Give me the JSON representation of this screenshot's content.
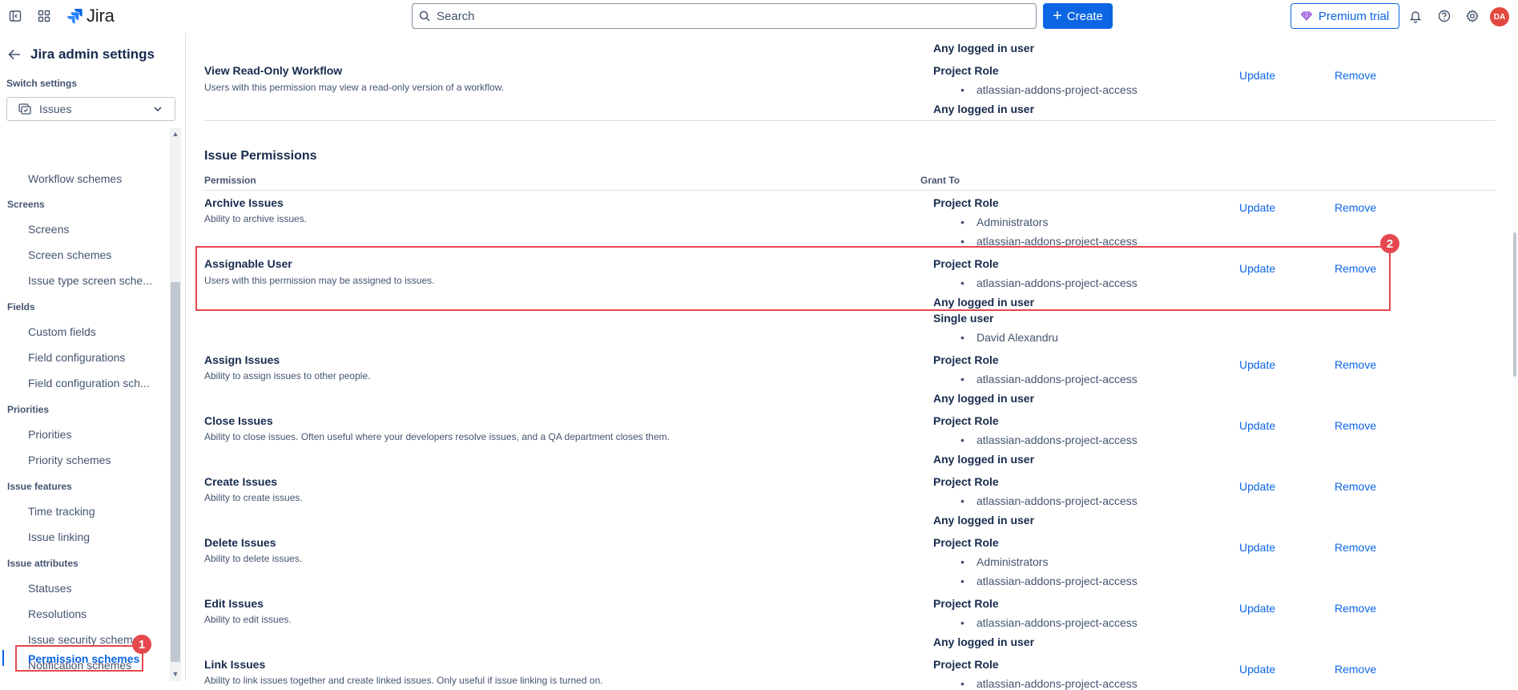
{
  "app": {
    "name": "Jira"
  },
  "search": {
    "placeholder": "Search"
  },
  "header": {
    "create_label": "Create",
    "premium_label": "Premium trial",
    "avatar_initials": "DA"
  },
  "sidebar": {
    "title": "Jira admin settings",
    "switch_label": "Switch settings",
    "select_value": "Issues",
    "groups": {
      "screens": "Screens",
      "fields": "Fields",
      "priorities": "Priorities",
      "issue_features": "Issue features",
      "issue_attributes": "Issue attributes"
    },
    "items": {
      "workflow_schemes": "Workflow schemes",
      "screens": "Screens",
      "screen_schemes": "Screen schemes",
      "issue_type_screen_schemes": "Issue type screen sche...",
      "custom_fields": "Custom fields",
      "field_configurations": "Field configurations",
      "field_configuration_schemes": "Field configuration sch...",
      "priorities": "Priorities",
      "priority_schemes": "Priority schemes",
      "time_tracking": "Time tracking",
      "issue_linking": "Issue linking",
      "statuses": "Statuses",
      "resolutions": "Resolutions",
      "issue_security_schemes": "Issue security schemes",
      "notification_schemes": "Notification schemes",
      "permission_schemes": "Permission schemes"
    }
  },
  "markers": {
    "one": "1",
    "two": "2"
  },
  "main": {
    "top_any_logged": "Any logged in user",
    "view_readonly": {
      "name": "View Read-Only Workflow",
      "desc": "Users with this permission may view a read-only version of a workflow.",
      "grant1": "Project Role",
      "bullet1": "atlassian-addons-project-access",
      "grant2": "Any logged in user"
    },
    "section_title": "Issue Permissions",
    "col_permission": "Permission",
    "col_grant": "Grant To",
    "update": "Update",
    "remove": "Remove",
    "rows": [
      {
        "name": "Archive Issues",
        "desc": "Ability to archive issues.",
        "g1": "Project Role",
        "b1": "Administrators",
        "b2": "atlassian-addons-project-access"
      },
      {
        "name": "Assignable User",
        "desc": "Users with this permission may be assigned to issues.",
        "g1": "Project Role",
        "b1": "atlassian-addons-project-access",
        "g2": "Any logged in user",
        "g3": "Single user",
        "b3": "David Alexandru"
      },
      {
        "name": "Assign Issues",
        "desc": "Ability to assign issues to other people.",
        "g1": "Project Role",
        "b1": "atlassian-addons-project-access",
        "g2": "Any logged in user"
      },
      {
        "name": "Close Issues",
        "desc": "Ability to close issues. Often useful where your developers resolve issues, and a QA department closes them.",
        "g1": "Project Role",
        "b1": "atlassian-addons-project-access",
        "g2": "Any logged in user"
      },
      {
        "name": "Create Issues",
        "desc": "Ability to create issues.",
        "g1": "Project Role",
        "b1": "atlassian-addons-project-access",
        "g2": "Any logged in user"
      },
      {
        "name": "Delete Issues",
        "desc": "Ability to delete issues.",
        "g1": "Project Role",
        "b1": "Administrators",
        "b2": "atlassian-addons-project-access"
      },
      {
        "name": "Edit Issues",
        "desc": "Ability to edit issues.",
        "g1": "Project Role",
        "b1": "atlassian-addons-project-access",
        "g2": "Any logged in user"
      },
      {
        "name": "Link Issues",
        "desc": "Ability to link issues together and create linked issues. Only useful if issue linking is turned on.",
        "g1": "Project Role",
        "b1": "atlassian-addons-project-access"
      }
    ]
  }
}
